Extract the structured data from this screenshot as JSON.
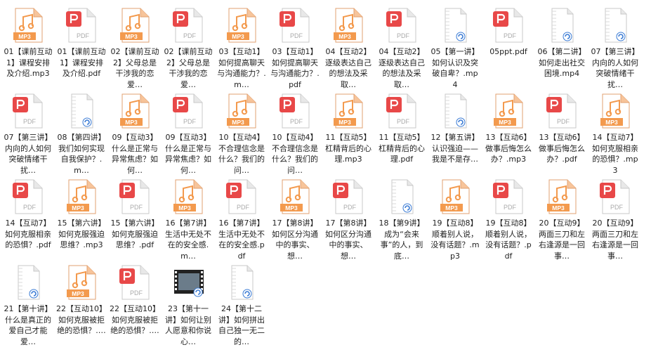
{
  "files": [
    {
      "type": "mp3",
      "label": "01【课前互动1】课程安排及介绍.mp3"
    },
    {
      "type": "pdf",
      "label": "01【课前互动1】课程安排及介绍.pdf"
    },
    {
      "type": "mp3",
      "label": "02【课前互动2】父母总是干涉我的恋爱…"
    },
    {
      "type": "pdf",
      "label": "02【课前互动2】父母总是干涉我的恋爱…"
    },
    {
      "type": "mp3",
      "label": "03【互动1】如何提高聊天与沟通能力？.m…"
    },
    {
      "type": "pdf",
      "label": "03【互动1】如何提高聊天与沟通能力？.pdf"
    },
    {
      "type": "mp3",
      "label": "04【互动2】逐级表达自己的想法及采取…"
    },
    {
      "type": "pdf",
      "label": "04【互动2】逐级表达自己的想法及采取…"
    },
    {
      "type": "video",
      "label": "05【第一讲】如何认识及突破自卑？.mp4"
    },
    {
      "type": "ppt",
      "label": "05ppt.pdf"
    },
    {
      "type": "video",
      "label": "06【第二讲】如何走出社交困境.mp4"
    },
    {
      "type": "video",
      "label": "07【第三讲】内向的人如何突破情绪干扰…"
    },
    {
      "type": "pdf",
      "label": "07【第三讲】内向的人如何突破情绪干扰…"
    },
    {
      "type": "video",
      "label": "08【第四讲】我们如何实现自我保护？.m…"
    },
    {
      "type": "mp3",
      "label": "09【互动3】什么是正常与异常焦虑？如何…"
    },
    {
      "type": "pdf",
      "label": "09【互动3】什么是正常与异常焦虑？如何…"
    },
    {
      "type": "mp3",
      "label": "10【互动4】不合理信念是什么？我们的问…"
    },
    {
      "type": "pdf",
      "label": "10【互动4】不合理信念是什么？我们的问…"
    },
    {
      "type": "mp3",
      "label": "11【互动5】杠精背后的心理.mp3"
    },
    {
      "type": "pdf",
      "label": "11【互动5】杠精背后的心理.pdf"
    },
    {
      "type": "video",
      "label": "12【第五讲】认识强迫——我是不是存…"
    },
    {
      "type": "mp3",
      "label": "13【互动6】做事后悔怎么办？.mp3"
    },
    {
      "type": "pdf",
      "label": "13【互动6】做事后悔怎么办？.pdf"
    },
    {
      "type": "mp3",
      "label": "14【互动7】如何克服相亲的恐惧？.mp3"
    },
    {
      "type": "pdf",
      "label": "14【互动7】如何克服相亲的恐惧？.pdf"
    },
    {
      "type": "mp3",
      "label": "15【第六讲】如何克服强迫思维？.mp3"
    },
    {
      "type": "pdf",
      "label": "15【第六讲】如何克服强迫思维？.pdf"
    },
    {
      "type": "mp3",
      "label": "16【第7讲】生活中无处不在的安全感.m…"
    },
    {
      "type": "pdf",
      "label": "16【第7讲】生活中无处不在的安全感.pdf"
    },
    {
      "type": "mp3",
      "label": "17【第8讲】如何区分沟通中的事实、想…"
    },
    {
      "type": "pdf",
      "label": "17【第8讲】如何区分沟通中的事实、想…"
    },
    {
      "type": "video",
      "label": "18【第9讲】成为“会来事”的人，到底…"
    },
    {
      "type": "mp3",
      "label": "19【互动8】顺着别人说，没有话题？.mp3"
    },
    {
      "type": "pdf",
      "label": "19【互动8】顺着别人说，没有话题？.pdf"
    },
    {
      "type": "mp3",
      "label": "20【互动9】两面三刀和左右逢源是一回事…"
    },
    {
      "type": "pdf",
      "label": "20【互动9】两面三刀和左右逢源是一回事…"
    },
    {
      "type": "video",
      "label": "21【第十讲】什么是真正的爱自己才能爱…"
    },
    {
      "type": "mp3",
      "label": "22【互动10】如何克服被拒绝的恐惧？.…"
    },
    {
      "type": "pdf",
      "label": "22【互动10】如何克服被拒绝的恐惧？.…"
    },
    {
      "type": "film",
      "label": "23【第十一讲】如何让别人愿意和你说心…"
    },
    {
      "type": "video",
      "label": "24【第十二讲】如何拼出自己独一无二的…"
    }
  ],
  "icon_text": {
    "mp3": "MP3",
    "pdf": "PDF"
  },
  "colors": {
    "mp3_orange": "#F39A4E",
    "pdf_red": "#E84848",
    "label_text": "#222222"
  }
}
